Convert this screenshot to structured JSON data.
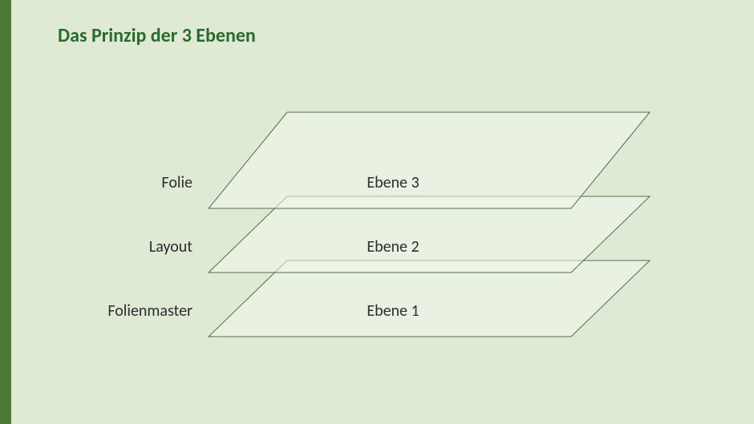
{
  "title": "Das Prinzip der 3 Ebenen",
  "layers": {
    "top": {
      "name": "Folie",
      "level": "Ebene 3"
    },
    "middle": {
      "name": "Layout",
      "level": "Ebene 2"
    },
    "bottom": {
      "name": "Folienmaster",
      "level": "Ebene 1"
    }
  }
}
